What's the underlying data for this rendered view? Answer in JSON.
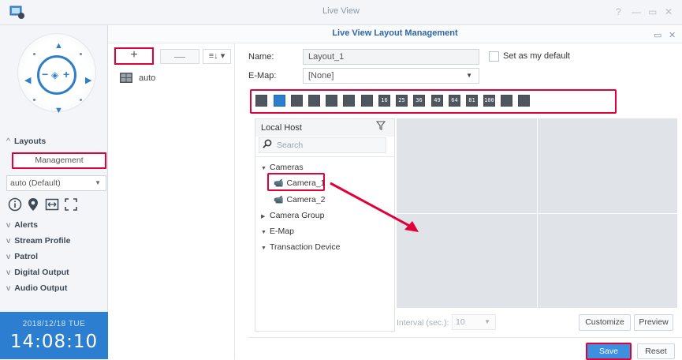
{
  "window": {
    "title": "Live View",
    "controls": [
      "?",
      "—",
      "▭",
      "✕"
    ]
  },
  "dialog": {
    "title": "Live View Layout Management",
    "controls": [
      "▭",
      "✕"
    ]
  },
  "sidebar": {
    "sections": {
      "layouts": "Layouts",
      "alerts": "Alerts",
      "stream_profile": "Stream Profile",
      "patrol": "Patrol",
      "digital_output": "Digital Output",
      "audio_output": "Audio Output"
    },
    "management_label": "Management",
    "layout_select": "auto (Default)",
    "tools": [
      "info-icon",
      "location-pin-icon",
      "fit-width-icon",
      "fullscreen-icon"
    ],
    "date": "2018/12/18 TUE",
    "time": "14:08:10"
  },
  "layout_list": {
    "add_label": "+",
    "remove_label": "—",
    "sort_label": "≡↓ ▾",
    "items": [
      {
        "label": "auto"
      }
    ]
  },
  "form": {
    "name_label": "Name:",
    "name_value": "Layout_1",
    "emap_label": "E-Map:",
    "emap_value": "[None]",
    "default_label": "Set as my default"
  },
  "layout_options": [
    "1",
    "4",
    "6",
    "9",
    "10",
    "12",
    "13",
    "16",
    "25",
    "36",
    "49",
    "64",
    "81",
    "100",
    "camera",
    "fisheye"
  ],
  "layout_option_labels": [
    "",
    "",
    "",
    "",
    "",
    "",
    "",
    "16",
    "25",
    "36",
    "49",
    "64",
    "81",
    "100",
    "",
    ""
  ],
  "source_tree": {
    "header": "Local Host",
    "search_placeholder": "Search",
    "nodes": {
      "cameras": "Cameras",
      "camera_1": "Camera_1",
      "camera_2": "Camera_2",
      "camera_group": "Camera Group",
      "emap": "E-Map",
      "transaction": "Transaction Device"
    }
  },
  "preview": {
    "interval_label": "Interval (sec.):",
    "interval_value": "10",
    "customize_label": "Customize",
    "preview_label": "Preview"
  },
  "footer": {
    "save_label": "Save",
    "reset_label": "Reset"
  },
  "colors": {
    "accent": "#2c7fd0",
    "highlight": "#e1003a",
    "save": "#3d8fe0"
  }
}
